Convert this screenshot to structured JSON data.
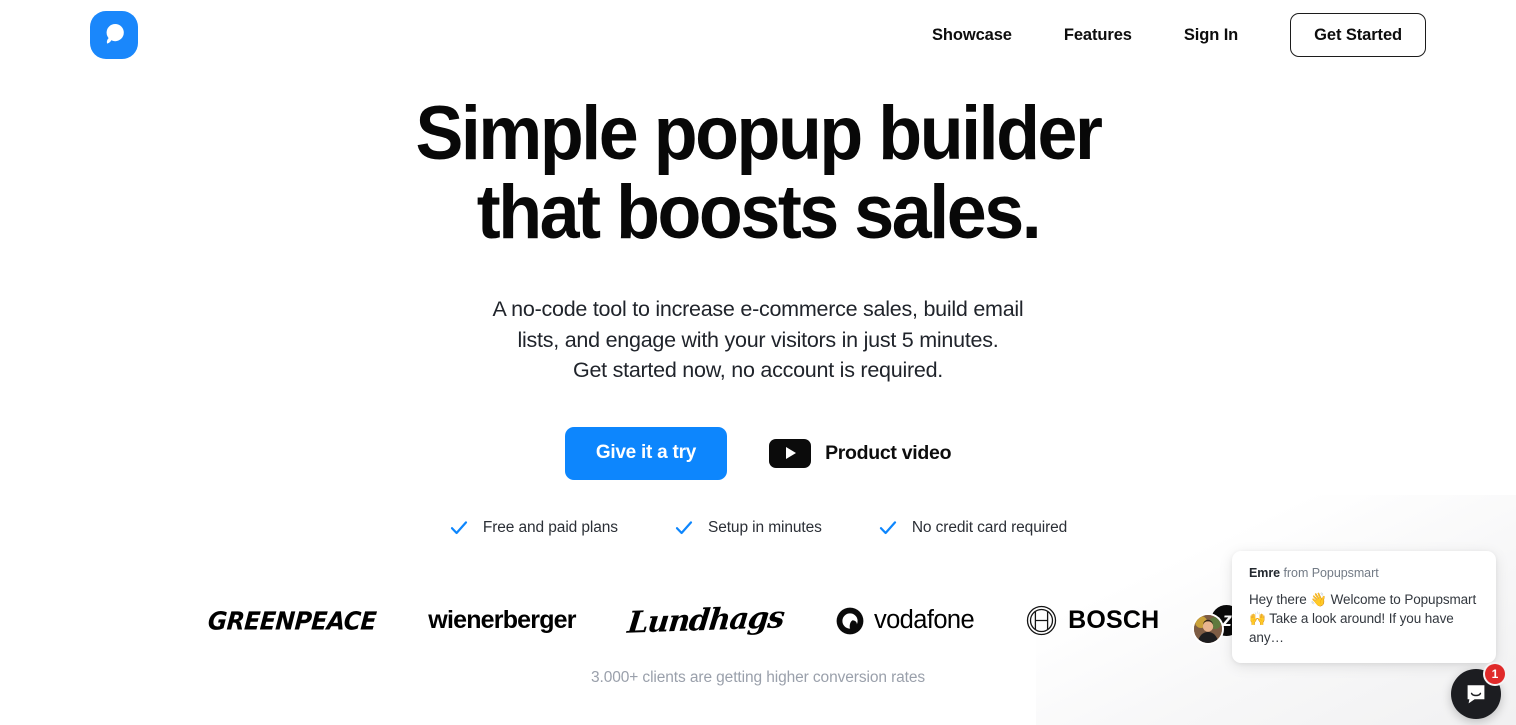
{
  "brand": {
    "logo_icon": "popupsmart-bubble-logo",
    "accent_color": "#0d86fd",
    "logo_bg": "#1a87fb"
  },
  "nav": {
    "links": [
      {
        "label": "Showcase",
        "name": "nav-link-showcase"
      },
      {
        "label": "Features",
        "name": "nav-link-features"
      },
      {
        "label": "Sign In",
        "name": "nav-link-sign-in"
      }
    ],
    "cta_label": "Get Started"
  },
  "hero": {
    "headline_line1": "Simple popup builder",
    "headline_line2": "that boosts sales.",
    "subhead_line1": "A no-code tool to increase e-commerce sales, build email",
    "subhead_line2": "lists, and engage with your visitors in just 5 minutes.",
    "subhead_line3": "Get started now, no account is required.",
    "primary_cta": "Give it a try",
    "video_label": "Product video",
    "video_icon": "play-button-icon",
    "ticks": [
      {
        "label": "Free and paid plans",
        "icon": "check-icon"
      },
      {
        "label": "Setup in minutes",
        "icon": "check-icon"
      },
      {
        "label": "No credit card required",
        "icon": "check-icon"
      }
    ]
  },
  "clients": {
    "logos": [
      {
        "name": "greenpeace",
        "label": "GREENPEACE"
      },
      {
        "name": "wienerberger",
        "label": "wienerberger"
      },
      {
        "name": "lundhags",
        "label": "Lundhags"
      },
      {
        "name": "vodafone",
        "label": "vodafone"
      },
      {
        "name": "bosch",
        "label": "BOSCH"
      },
      {
        "name": "zolar",
        "label": "zolar",
        "mark": "z"
      }
    ],
    "caption": "3.000+ clients are getting higher conversion rates"
  },
  "chat": {
    "sender_name": "Emre",
    "sender_suffix": " from Popupsmart",
    "message_line1": "Hey there 👋 Welcome to Popupsmart",
    "message_line2": "🙌 Take a look around! If you have any…",
    "avatar_icon": "user-avatar",
    "launcher_icon": "chat-bubble-icon",
    "unread_count": "1",
    "badge_color": "#e02a2a"
  }
}
